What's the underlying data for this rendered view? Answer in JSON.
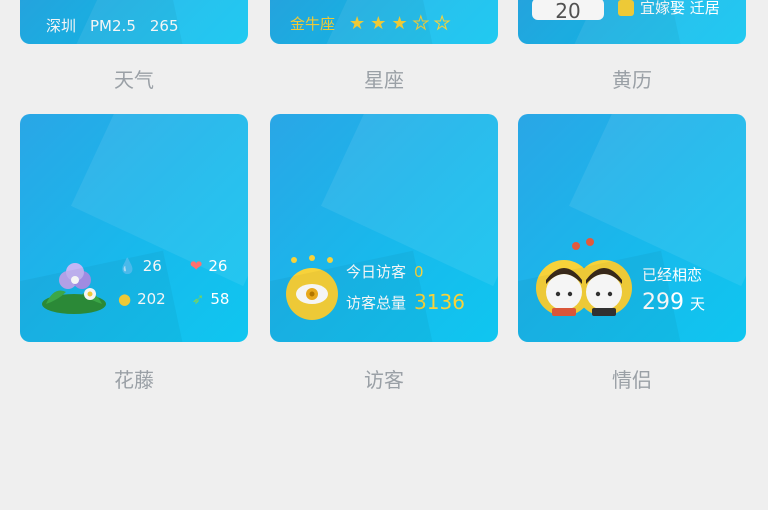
{
  "top_tiles": {
    "weather": {
      "city": "深圳",
      "pm_label": "PM2.5",
      "pm_value": "265",
      "label": "天气"
    },
    "horoscope": {
      "sign": "金牛座",
      "rating": 3,
      "rating_max": 5,
      "label": "星座"
    },
    "calendar": {
      "day": "20",
      "text": "宜嫁娶 迁居",
      "label": "黄历"
    }
  },
  "tiles": {
    "flowers": {
      "stat1": "26",
      "stat2": "26",
      "stat3": "202",
      "stat4": "58",
      "label": "花藤"
    },
    "visitors": {
      "today_label": "今日访客",
      "today_value": "0",
      "total_label": "访客总量",
      "total_value": "3136",
      "label": "访客"
    },
    "couple": {
      "line1": "已经相恋",
      "days": "299",
      "days_unit": "天",
      "label": "情侣"
    }
  },
  "colors": {
    "tile_blue": "#18b9ec",
    "accent_yellow": "#f7d23a",
    "page_bg": "#efefef",
    "label_gray": "#9aa0a6"
  }
}
